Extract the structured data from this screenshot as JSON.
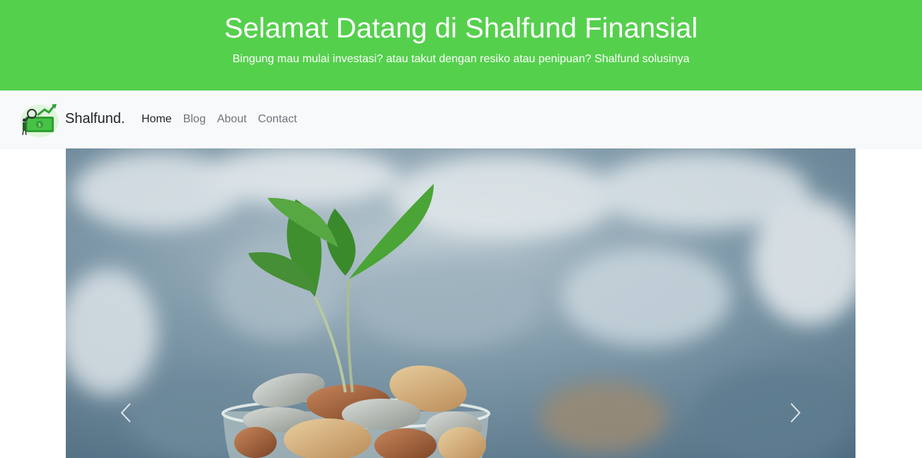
{
  "header": {
    "title": "Selamat Datang di Shalfund Finansial",
    "subtitle": "Bingung mau mulai investasi? atau takut dengan resiko atau penipuan? Shalfund solusinya",
    "background_color": "#55d04d"
  },
  "navbar": {
    "brand_name": "Shalfund.",
    "brand_icon": "money-growth-logo-icon",
    "links": [
      {
        "label": "Home",
        "active": true
      },
      {
        "label": "Blog",
        "active": false
      },
      {
        "label": "About",
        "active": false
      },
      {
        "label": "Contact",
        "active": false
      }
    ]
  },
  "carousel": {
    "image": "plant-growing-from-coins-in-jar",
    "prev_icon": "chevron-left-icon",
    "next_icon": "chevron-right-icon"
  }
}
